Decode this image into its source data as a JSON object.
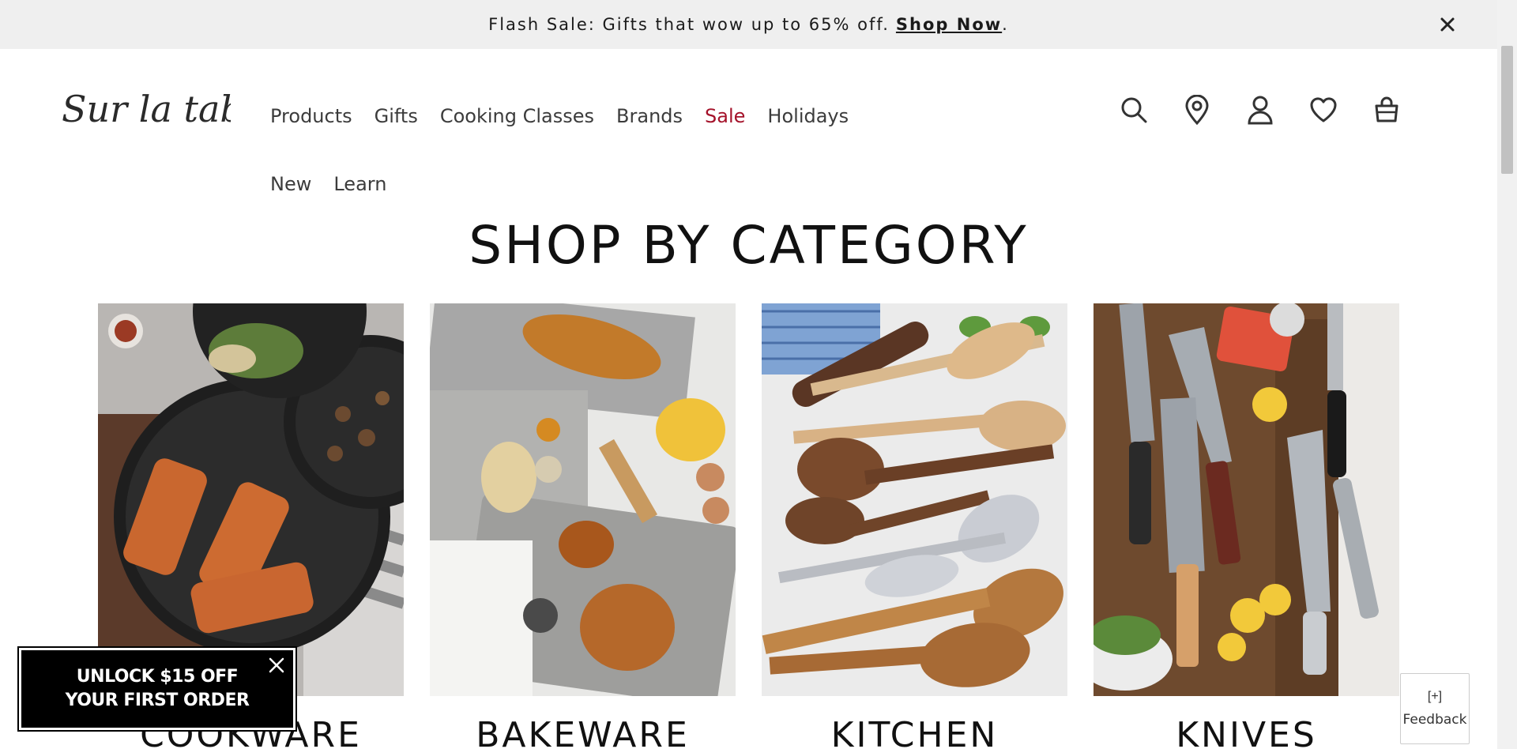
{
  "promo": {
    "text": "Flash Sale: Gifts that wow up to 65% off.",
    "link_label": "Shop Now",
    "period": "."
  },
  "brand": {
    "logo_text": "Sur la table"
  },
  "nav": {
    "items": [
      {
        "label": "Products"
      },
      {
        "label": "Gifts"
      },
      {
        "label": "Cooking Classes"
      },
      {
        "label": "Brands"
      },
      {
        "label": "Sale"
      },
      {
        "label": "Holidays"
      },
      {
        "label": "New"
      },
      {
        "label": "Learn"
      }
    ],
    "sale_color": "#a4122a"
  },
  "header_icons": [
    "search-icon",
    "location-pin-icon",
    "account-icon",
    "heart-icon",
    "cart-icon"
  ],
  "section": {
    "title": "SHOP BY CATEGORY",
    "categories": [
      {
        "label": "COOKWARE"
      },
      {
        "label": "BAKEWARE"
      },
      {
        "label": "KITCHEN"
      },
      {
        "label": "KNIVES"
      }
    ]
  },
  "popup": {
    "line1": "UNLOCK $15 OFF",
    "line2": "YOUR FIRST ORDER"
  },
  "feedback": {
    "label": "Feedback",
    "icon_glyph": "[+]"
  }
}
